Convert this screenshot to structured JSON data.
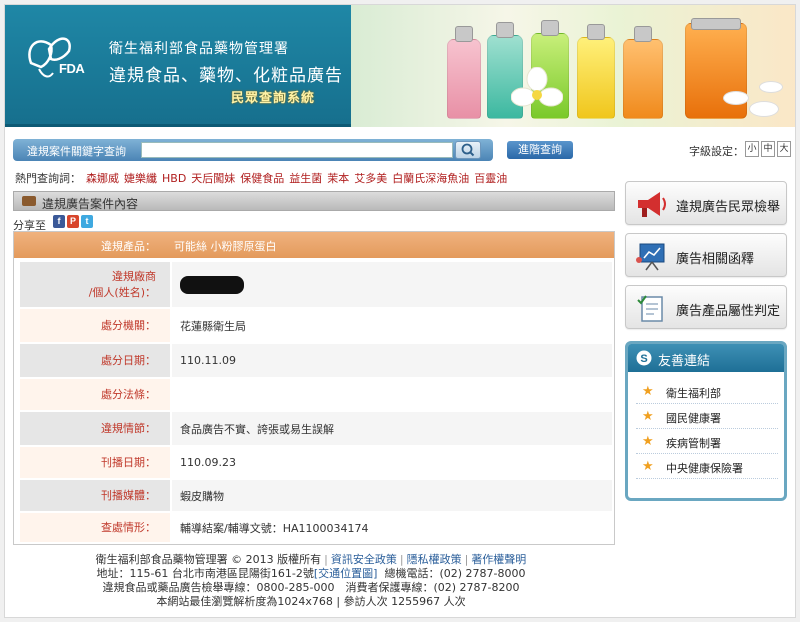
{
  "header": {
    "logo_text": "FDA",
    "agency": "衛生福利部食品藥物管理署",
    "title": "違規食品、藥物、化粧品廣告",
    "subtitle": "民眾查詢系統"
  },
  "search": {
    "label": "違規案件關鍵字查詢",
    "value": "",
    "placeholder": "",
    "advanced_label": "進階查詢"
  },
  "font_size": {
    "label": "字級設定：",
    "options": [
      "小",
      "中",
      "大"
    ]
  },
  "hot_keywords": {
    "label": "熱門查詢詞：",
    "items": [
      "森娜威",
      "婕樂纖",
      "HBD",
      "天后闖妹",
      "保健食品",
      "益生菌",
      "茉本",
      "艾多美",
      "白蘭氏深海魚油",
      "百靈油"
    ]
  },
  "section": {
    "title": "違規廣告案件內容"
  },
  "share": {
    "label": "分享至",
    "services": [
      "facebook-icon",
      "plurk-icon",
      "twitter-icon"
    ]
  },
  "case": {
    "header_label": "違規產品：",
    "header_value": "可能絲 小粉膠原蛋白",
    "rows": [
      {
        "label_1": "違規廠商",
        "label_2": "/個人(姓名)：",
        "value": ""
      },
      {
        "label": "處分機關：",
        "value": "花蓮縣衛生局"
      },
      {
        "label": "處分日期：",
        "value": "110.11.09"
      },
      {
        "label": "處分法條：",
        "value": ""
      },
      {
        "label": "違規情節：",
        "value": "食品廣告不實、誇張或易生誤解"
      },
      {
        "label": "刊播日期：",
        "value": "110.09.23"
      },
      {
        "label": "刊播媒體：",
        "value": "蝦皮購物"
      },
      {
        "label": "查處情形：",
        "value": "輔導結案/輔導文號：HA1100034174"
      }
    ]
  },
  "sidebar": {
    "buttons": [
      {
        "label": "違規廣告民眾檢舉",
        "icon": "megaphone-icon"
      },
      {
        "label": "廣告相關函釋",
        "icon": "presentation-board-icon"
      },
      {
        "label": "廣告產品屬性判定",
        "icon": "checklist-icon"
      }
    ],
    "links": {
      "title": "友善連結",
      "items": [
        "衛生福利部",
        "國民健康署",
        "疾病管制署",
        "中央健康保險署"
      ]
    }
  },
  "footer": {
    "copyright": "衛生福利部食品藥物管理署 © 2013 版權所有",
    "links": [
      "資訊安全政策",
      "隱私權政策",
      "著作權聲明"
    ],
    "address_prefix": "地址：115-61 台北市南港區昆陽街161-2號",
    "map_link": "[交通位置圖]",
    "phone": "總機電話：(02) 2787-8000",
    "hotline": "違規食品或藥品廣告檢舉專線：0800-285-000　消費者保護專線：(02) 2787-8200",
    "note": "本網站最佳瀏覽解析度為1024x768 | 參訪人次 1255967 人次"
  },
  "colors": {
    "header_blue": "#1f87a6",
    "table_header": "#e8a26a",
    "label_red": "#c0392b",
    "keyword_red": "#b01e1e",
    "link_blue": "#2a5e9a"
  }
}
